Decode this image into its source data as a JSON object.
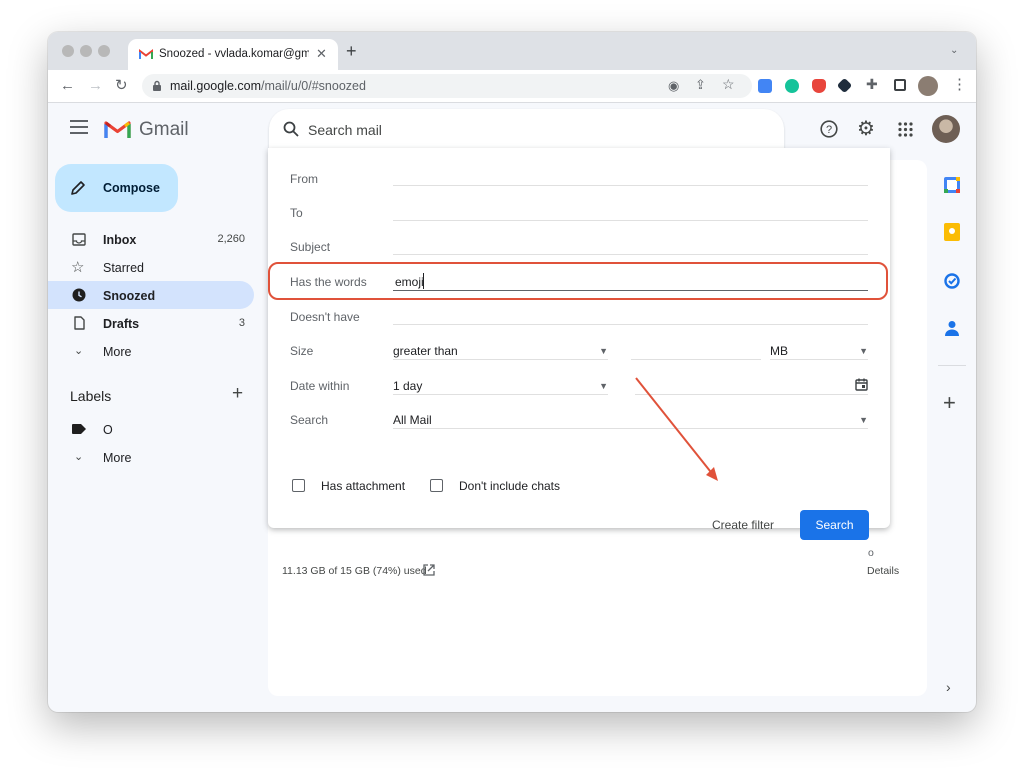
{
  "browser": {
    "tab_title": "Snoozed - vvlada.komar@gma",
    "new_tab": "+",
    "url_host": "mail.google.com",
    "url_path": "/mail/u/0/#snoozed"
  },
  "gmail": {
    "brand": "Gmail",
    "search_placeholder": "Search mail",
    "compose_label": "Compose",
    "nav": [
      {
        "label": "Inbox",
        "count": "2,260",
        "bold": true,
        "icon": "inbox-icon"
      },
      {
        "label": "Starred",
        "count": "",
        "bold": false,
        "icon": "star-icon"
      },
      {
        "label": "Snoozed",
        "count": "",
        "bold": true,
        "icon": "clock-icon"
      },
      {
        "label": "Drafts",
        "count": "3",
        "bold": true,
        "icon": "draft-icon"
      },
      {
        "label": "More",
        "count": "",
        "bold": false,
        "icon": "chevron-down-icon"
      }
    ],
    "labels_heading": "Labels",
    "labels": [
      {
        "label": "O"
      },
      {
        "label": "More"
      }
    ]
  },
  "advanced_search": {
    "from_label": "From",
    "to_label": "To",
    "subject_label": "Subject",
    "has_words_label": "Has the words",
    "has_words_value": "emoji",
    "doesnt_have_label": "Doesn't have",
    "size_label": "Size",
    "size_operator": "greater than",
    "size_unit": "MB",
    "date_within_label": "Date within",
    "date_within_value": "1 day",
    "search_label": "Search",
    "search_scope": "All Mail",
    "has_attachment_label": "Has attachment",
    "dont_include_chats_label": "Don't include chats",
    "create_filter_label": "Create filter",
    "search_button_label": "Search"
  },
  "footer": {
    "storage": "11.13 GB of 15 GB (74%) used",
    "details": "Details",
    "partial": "o"
  },
  "colors": {
    "accent_blue": "#1a73e8",
    "annotation_red": "#e0523a",
    "compose_bg": "#c2e7ff",
    "selected_nav": "#d3e3fd"
  }
}
